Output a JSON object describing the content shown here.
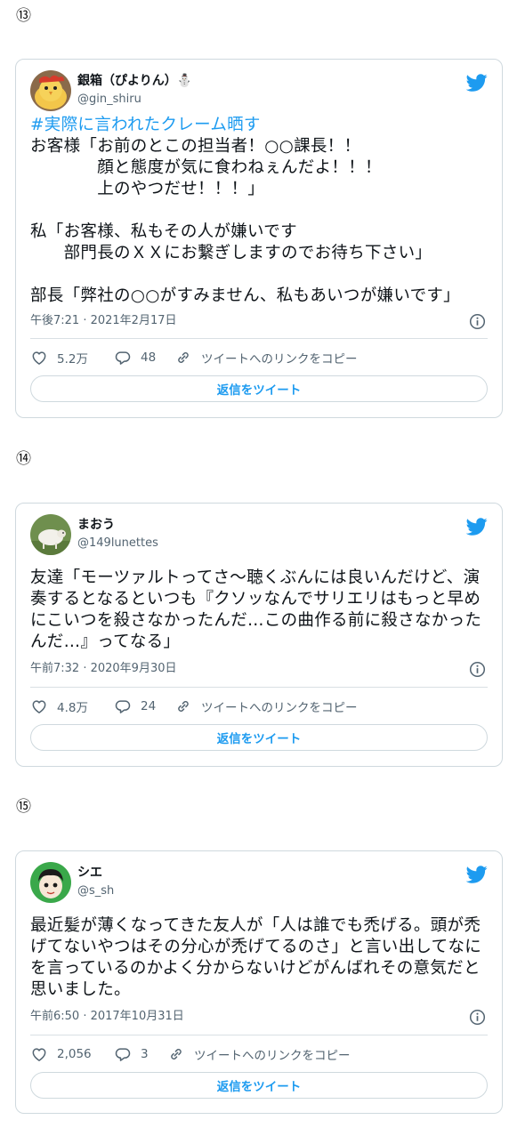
{
  "tweet_action_common": {
    "copy_link_label": "ツイートへのリンクをコピー",
    "reply_button_label": "返信をツイート"
  },
  "tweets": [
    {
      "number": "⑬",
      "display_name": "銀箱（ぴよりん）⛄",
      "handle": "@gin_shiru",
      "hashtag": "#実際に言われたクレーム晒す",
      "body": "お客様「お前のとこの担当者！○○課長！！\n　　　　顔と態度が気に食わねぇんだよ！！！\n　　　　上のやつだせ！！！」\n\n私「お客様、私もその人が嫌いです\n　　部門長のＸＸにお繋ぎしますのでお待ち下さい」\n\n部長「弊社の○○がすみません、私もあいつが嫌いです」",
      "timestamp": "午後7:21 · 2021年2月17日",
      "likes": "5.2万",
      "replies": "48"
    },
    {
      "number": "⑭",
      "display_name": "まおう",
      "handle": "@149lunettes",
      "hashtag": "",
      "body": "友達「モーツァルトってさ〜聴くぶんには良いんだけど、演奏するとなるといつも『クソッなんでサリエリはもっと早めにこいつを殺さなかったんだ…この曲作る前に殺さなかったんだ…』ってなる」",
      "timestamp": "午前7:32 · 2020年9月30日",
      "likes": "4.8万",
      "replies": "24"
    },
    {
      "number": "⑮",
      "display_name": "シエ",
      "handle": "@s_sh",
      "hashtag": "",
      "body": "最近髪が薄くなってきた友人が「人は誰でも禿げる。頭が禿げてないやつはその分心が禿げてるのさ」と言い出してなにを言っているのかよく分からないけどがんばれその意気だと思いました。",
      "timestamp": "午前6:50 · 2017年10月31日",
      "likes": "2,056",
      "replies": "3"
    }
  ],
  "colors": {
    "accent": "#1d9bf0",
    "secondary_text": "#536471",
    "border": "#cfd9de"
  },
  "icons": [
    "twitter-bird-icon",
    "info-icon",
    "heart-icon",
    "reply-bubble-icon",
    "link-icon"
  ]
}
